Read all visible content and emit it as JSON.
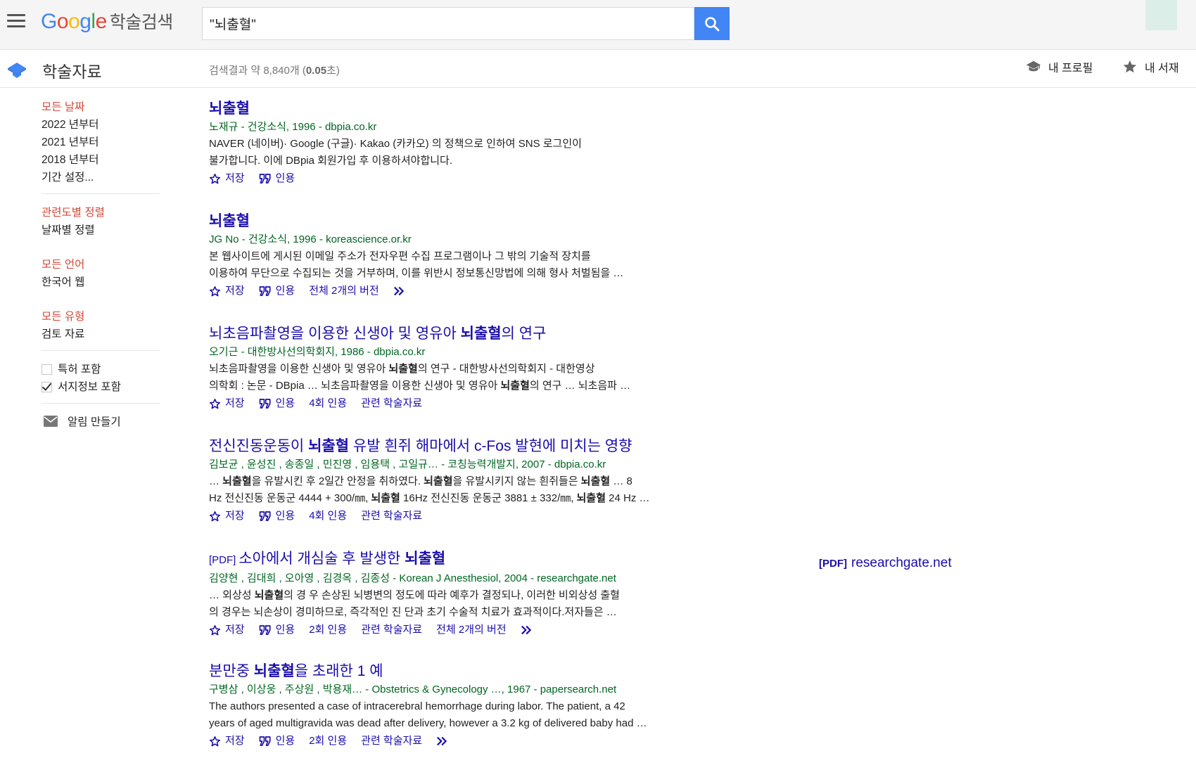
{
  "header": {
    "logo_word": "Google",
    "logo_suffix": "학술검색",
    "search_value": "\"뇌출혈\"",
    "colors": {
      "blue": "#4285f4",
      "red": "#ea4335",
      "yellow": "#fbbc05",
      "green": "#34a853",
      "search_button": "#4285f4"
    }
  },
  "subheader": {
    "title": "학술자료",
    "stats_prefix": "검색결과 약 8,840개 (",
    "stats_time": "0.05",
    "stats_suffix": "초)",
    "profile_label": "내 프로필",
    "library_label": "내 서재"
  },
  "sidebar": {
    "date": [
      "모든 날짜",
      "2022 년부터",
      "2021 년부터",
      "2018 년부터",
      "기간 설정..."
    ],
    "sort": [
      "관련도별 정렬",
      "날짜별 정렬"
    ],
    "lang": [
      "모든 언어",
      "한국어 웹"
    ],
    "type": [
      "모든 유형",
      "검토 자료"
    ],
    "checks": [
      {
        "label": "특허 포함",
        "checked": false
      },
      {
        "label": "서지정보 포함",
        "checked": true
      }
    ],
    "alert_label": "알림 만들기"
  },
  "results": [
    {
      "tag": "",
      "title_pre": "",
      "title_bold": "뇌출혈",
      "title_post": "",
      "meta": "노재규 - 건강소식, 1996 - dbpia.co.kr",
      "snippet_html": "NAVER (네이버)· Google (구글)· Kakao (카카오) 의 정책으로 인하여 SNS 로그인이<br>불가합니다. 이에 DBpia 회원가입 후 이용하셔야합니다.",
      "actions": [
        "저장",
        "인용"
      ],
      "more": false
    },
    {
      "tag": "",
      "title_pre": "",
      "title_bold": "뇌출혈",
      "title_post": "",
      "meta": "JG No - 건강소식, 1996 - koreascience.or.kr",
      "snippet_html": "본 웹사이트에 게시된 이메일 주소가 전자우편 수집 프로그램이나 그 밖의 기술적 장치를<br>이용하여 무단으로 수집되는 것을 거부하며, 이를 위반시 정보통신망법에 의해 형사 처벌됨을 …",
      "actions": [
        "저장",
        "인용",
        "전체 2개의 버전"
      ],
      "more": true
    },
    {
      "tag": "",
      "title_pre": "뇌초음파촬영을 이용한 신생아 및 영유아 ",
      "title_bold": "뇌출혈",
      "title_post": "의 연구",
      "meta": "오기근 - 대한방사선의학회지, 1986 - dbpia.co.kr",
      "snippet_html": "뇌초음파촬영을 이용한 신생아 및 영유아 <b>뇌출혈</b>의 연구 - 대한방사선의학회지 - 대한영상<br>의학회 : 논문 - DBpia … 뇌초음파촬영을 이용한 신생아 및 영유아 <b>뇌출혈</b>의 연구 … 뇌초음파 …",
      "actions": [
        "저장",
        "인용",
        "4회 인용",
        "관련 학술자료"
      ],
      "more": false
    },
    {
      "tag": "",
      "title_pre": "전신진동운동이 ",
      "title_bold": "뇌출혈",
      "title_post": " 유발 흰쥐 해마에서 c-Fos 발현에 미치는 영향",
      "meta": "김보균 ,  윤성진 ,  송종일 ,  민진영 ,  임용택 ,  고일규… - 코칭능력개발지, 2007 - dbpia.co.kr",
      "snippet_html": "… <b>뇌출혈</b>을 유발시킨 후 2일간 안정을 취하였다. <b>뇌출혈</b>을 유발시키지 않는 흰쥐들은 <b>뇌출혈</b> … 8<br>Hz 전신진동 운동군 4444 + 300/㎜, <b>뇌출혈</b> 16Hz 전신진동 운동군 3881 ± 332/㎜, <b>뇌출혈</b> 24 Hz …",
      "actions": [
        "저장",
        "인용",
        "4회 인용",
        "관련 학술자료"
      ],
      "more": false
    },
    {
      "tag": "[PDF]",
      "title_pre": "소아에서 개심술 후 발생한 ",
      "title_bold": "뇌출혈",
      "title_post": "",
      "meta": "김양현 ,  김대희 ,  오아영 ,  김경옥 ,  김종성 - Korean J Anesthesiol, 2004 - researchgate.net",
      "snippet_html": "… 외상성 <b>뇌출혈</b>의 경 우 손상된 뇌병변의 정도에 따라 예후가 결정되나, 이러한 비외상성 출혈<br>의 경우는 뇌손상이 경미하므로, 즉각적인 진 단과 초기 수술적 치료가 효과적이다.저자들은 …",
      "actions": [
        "저장",
        "인용",
        "2회 인용",
        "관련 학술자료",
        "전체 2개의 버전"
      ],
      "more": true
    },
    {
      "tag": "",
      "title_pre": "분만중 ",
      "title_bold": "뇌출혈",
      "title_post": "을 초래한 1 예",
      "meta": "구병삼 ,  이상웅 ,  주상원 ,  박용재… - Obstetrics & Gynecology …, 1967 - papersearch.net",
      "snippet_html": "The authors presented a case of intracerebral hemorrhage during labor. The patient, a 42<br>years of aged multigravida was dead after delivery, however a 3.2 kg of delivered baby had …",
      "actions": [
        "저장",
        "인용",
        "2회 인용",
        "관련 학술자료"
      ],
      "more": true
    }
  ],
  "side_pdf": {
    "tag": "[PDF]",
    "site": "researchgate.net"
  }
}
